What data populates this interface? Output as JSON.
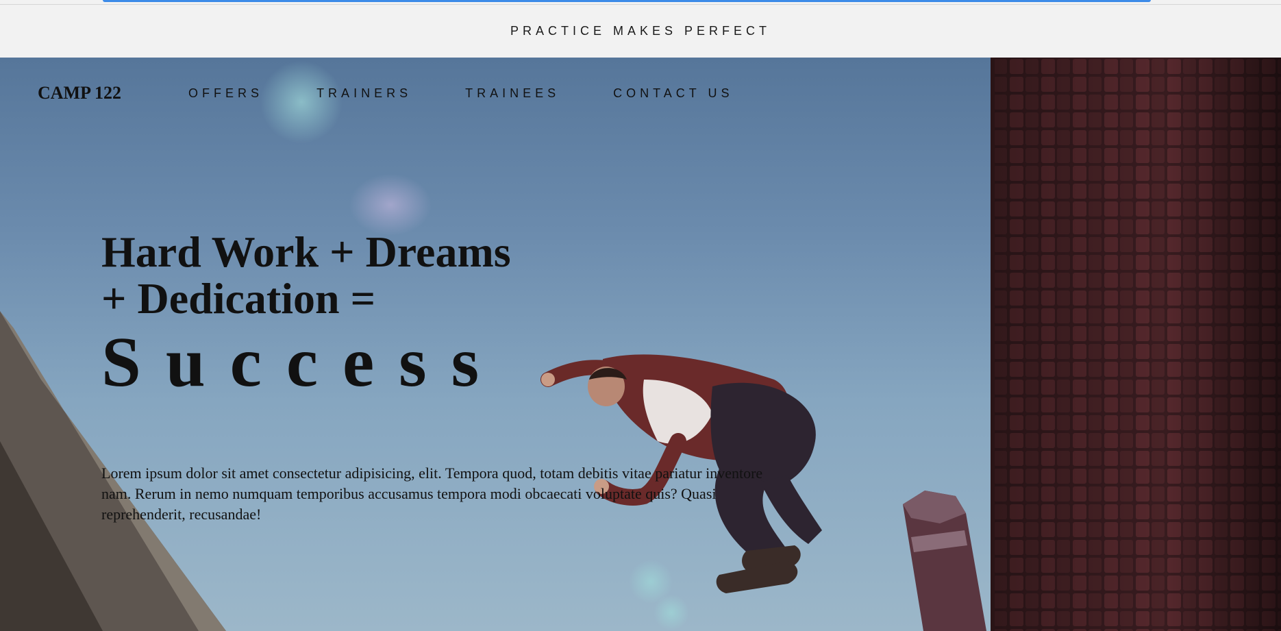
{
  "topbar": {
    "text": "PRACTICE MAKES PERFECT"
  },
  "nav": {
    "brand": "CAMP 122",
    "links": [
      "OFFERS",
      "TRAINERS",
      "TRAINEES",
      "CONTACT US"
    ]
  },
  "hero": {
    "headline_line1": "Hard Work + Dreams",
    "headline_line2": "+ Dedication =",
    "headline_big": "Success",
    "body": "Lorem ipsum dolor sit amet consectetur adipisicing, elit. Tempora quod, totam debitis vitae pariatur inventore nam. Rerum in nemo numquam temporibus accusamus tempora modi obcaecati voluptate quis? Quasi reprehenderit, recusandae!"
  },
  "colors": {
    "accent": "#3d8be8",
    "topbar_bg": "#f2f2f2",
    "sky": "#6b8bad",
    "brick": "#4a2226"
  }
}
